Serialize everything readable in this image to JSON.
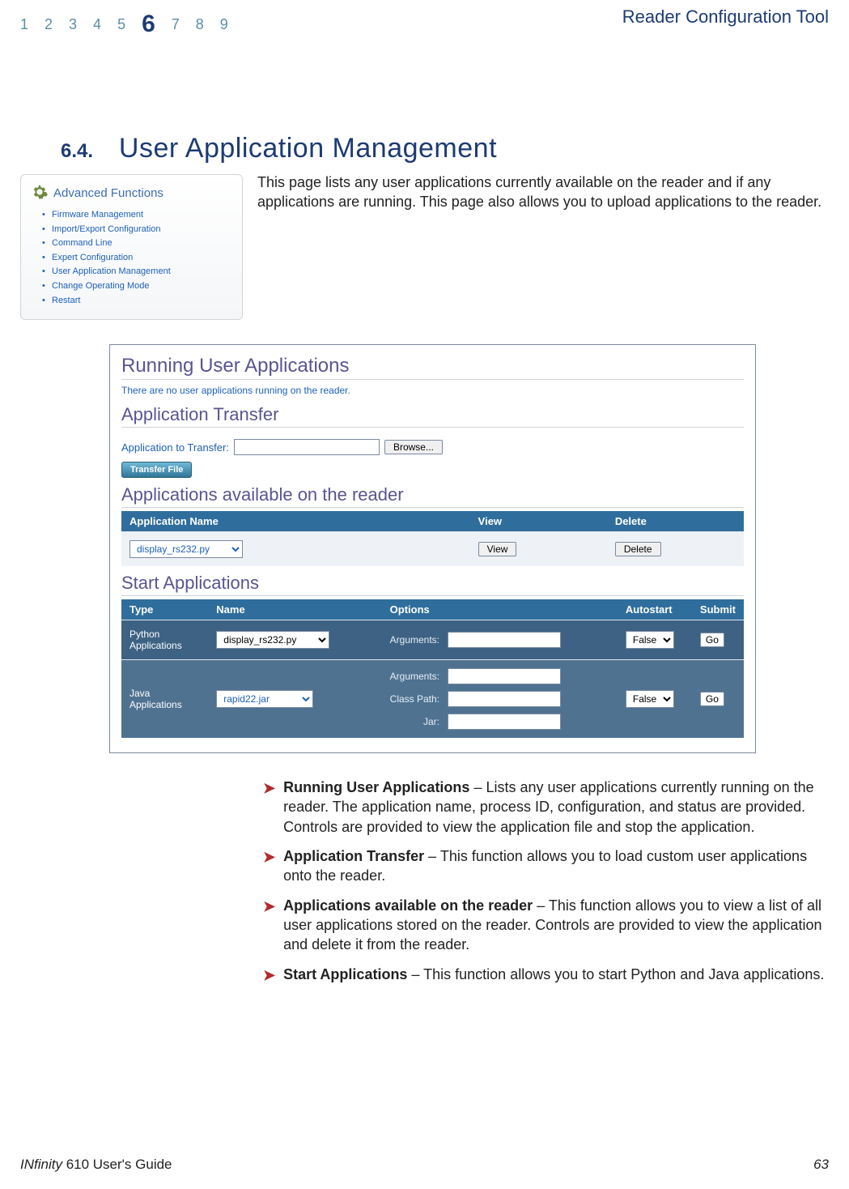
{
  "header": {
    "chapters": [
      "1",
      "2",
      "3",
      "4",
      "5",
      "6",
      "7",
      "8",
      "9"
    ],
    "current_chapter": "6",
    "title": "Reader Configuration Tool"
  },
  "section": {
    "number": "6.4.",
    "title": "User Application Management"
  },
  "intro": "This page lists any user applications currently available on the reader and if any applications are running. This page also allows you to upload applications to the reader.",
  "adv_card": {
    "title": "Advanced Functions",
    "items": [
      "Firmware Management",
      "Import/Export Configuration",
      "Command Line",
      "Expert Configuration",
      "User Application Management",
      "Change Operating Mode",
      "Restart"
    ]
  },
  "panel": {
    "running_h": "Running User Applications",
    "running_note": "There are no user applications running on the reader.",
    "transfer_h": "Application Transfer",
    "transfer_label": "Application to Transfer:",
    "browse_btn": "Browse...",
    "transfer_file_btn": "Transfer File",
    "available_h": "Applications available on the reader",
    "avail_headers": [
      "Application Name",
      "View",
      "Delete"
    ],
    "avail_app": "display_rs232.py",
    "view_btn": "View",
    "delete_btn": "Delete",
    "start_h": "Start Applications",
    "start_headers": [
      "Type",
      "Name",
      "Options",
      "Autostart",
      "Submit"
    ],
    "python_row": {
      "type": "Python Applications",
      "app": "display_rs232.py",
      "arg_label": "Arguments:",
      "autostart": "False",
      "go": "Go"
    },
    "java_row": {
      "type": "Java Applications",
      "app": "rapid22.jar",
      "arg_label": "Arguments:",
      "cp_label": "Class Path:",
      "jar_label": "Jar:",
      "autostart": "False",
      "go": "Go"
    }
  },
  "desc": {
    "items": [
      {
        "b": "Running User Applications",
        "t": " – Lists any user applications currently running on the reader. The application name, process ID, configuration, and status are provided. Controls are provided to view the application file and stop the application."
      },
      {
        "b": "Application Transfer",
        "t": " – This function allows you to load custom user applications onto the reader."
      },
      {
        "b": "Applications available on the reader",
        "t": " – This function allows you to view a list of all user applications stored on the reader. Controls are provided to view the application and delete it from the reader."
      },
      {
        "b": "Start Applications",
        "t": " – This function allows you to start Python and Java applications."
      }
    ]
  },
  "footer": {
    "left_italic": "INfinity",
    "left_rest": " 610 User's Guide",
    "page": "63"
  }
}
